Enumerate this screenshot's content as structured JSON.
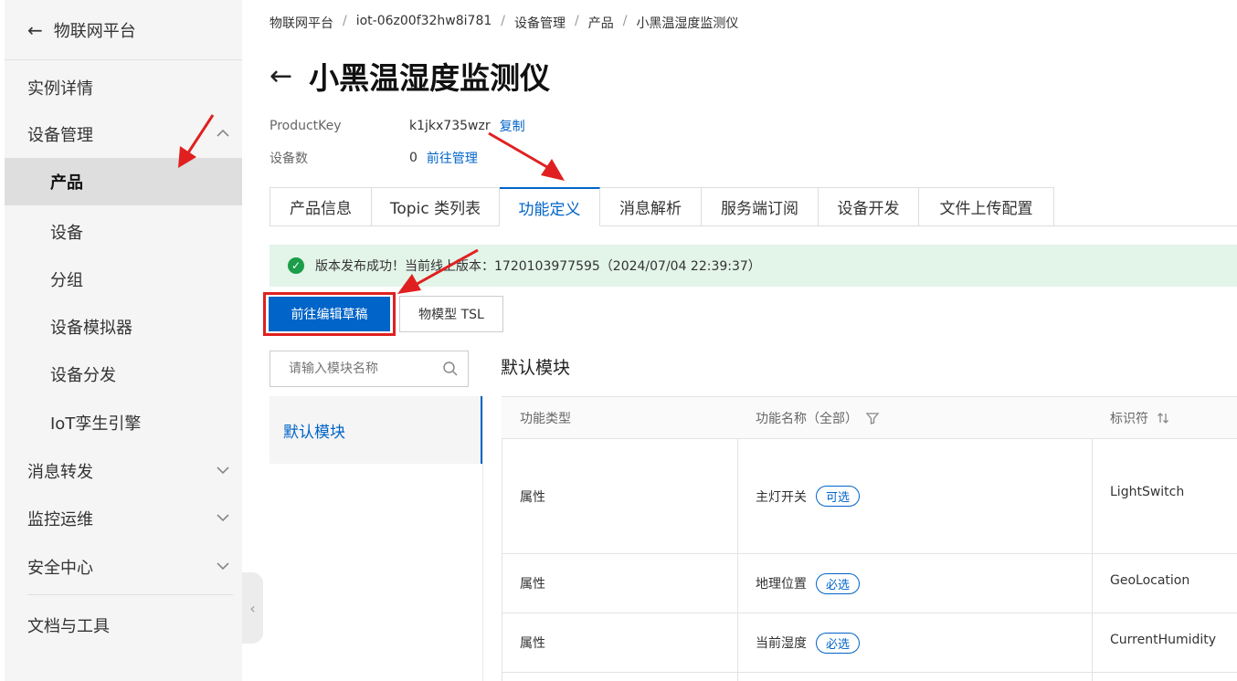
{
  "sidebar": {
    "header": "物联网平台",
    "items": [
      {
        "label": "实例详情"
      },
      {
        "label": "设备管理"
      },
      {
        "label": "产品"
      },
      {
        "label": "设备"
      },
      {
        "label": "分组"
      },
      {
        "label": "设备模拟器"
      },
      {
        "label": "设备分发"
      },
      {
        "label": "IoT孪生引擎"
      },
      {
        "label": "消息转发"
      },
      {
        "label": "监控运维"
      },
      {
        "label": "安全中心"
      },
      {
        "label": "文档与工具"
      }
    ],
    "collapse_glyph": "‹"
  },
  "breadcrumb": [
    "物联网平台",
    "iot-06z00f32hw8i781",
    "设备管理",
    "产品",
    "小黑温湿度监测仪"
  ],
  "breadcrumb_sep": "/",
  "page_title": "小黑温湿度监测仪",
  "meta": {
    "product_key_label": "ProductKey",
    "product_key_value": "k1jkx735wzr",
    "copy_link": "复制",
    "device_count_label": "设备数",
    "device_count_value": "0",
    "manage_link": "前往管理"
  },
  "tabs": [
    {
      "label": "产品信息"
    },
    {
      "label": "Topic 类列表"
    },
    {
      "label": "功能定义"
    },
    {
      "label": "消息解析"
    },
    {
      "label": "服务端订阅"
    },
    {
      "label": "设备开发"
    },
    {
      "label": "文件上传配置"
    }
  ],
  "notice": {
    "icon": "check-circle-icon",
    "text": "版本发布成功！当前线上版本：1720103977595（2024/07/04 22:39:37）"
  },
  "buttons": {
    "edit_draft": "前往编辑草稿",
    "tsl": "物模型 TSL"
  },
  "search": {
    "placeholder": "请输入模块名称"
  },
  "modules": [
    {
      "label": "默认模块"
    }
  ],
  "module_title": "默认模块",
  "table": {
    "headers": [
      "功能类型",
      "功能名称（全部）",
      "标识符"
    ],
    "rows": [
      {
        "type": "属性",
        "name": "主灯开关",
        "tag": "可选",
        "id": "LightSwitch"
      },
      {
        "type": "属性",
        "name": "地理位置",
        "tag": "必选",
        "id": "GeoLocation"
      },
      {
        "type": "属性",
        "name": "当前湿度",
        "tag": "必选",
        "id": "CurrentHumidity"
      }
    ]
  },
  "colors": {
    "accent": "#0064c8",
    "success_bg": "#e3f4e9",
    "success": "#1b9d4a",
    "annotation": "#e02020"
  }
}
